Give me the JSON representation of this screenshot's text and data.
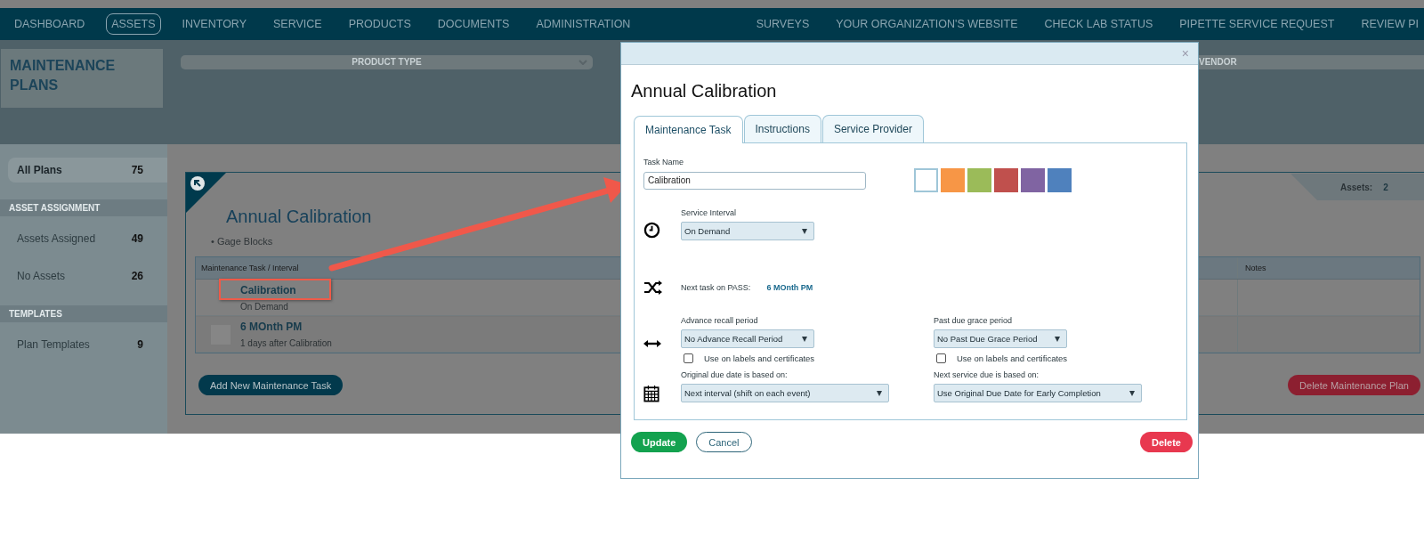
{
  "nav": {
    "items": [
      {
        "label": "DASHBOARD",
        "selected": false
      },
      {
        "label": "ASSETS",
        "selected": true
      },
      {
        "label": "INVENTORY",
        "selected": false
      },
      {
        "label": "SERVICE",
        "selected": false
      },
      {
        "label": "PRODUCTS",
        "selected": false
      },
      {
        "label": "DOCUMENTS",
        "selected": false
      },
      {
        "label": "ADMINISTRATION",
        "selected": false
      }
    ],
    "right_items": [
      {
        "label": "SURVEYS",
        "selected": false
      },
      {
        "label": "YOUR ORGANIZATION'S WEBSITE",
        "selected": false
      },
      {
        "label": "CHECK LAB STATUS",
        "selected": false
      },
      {
        "label": "PIPETTE SERVICE REQUEST",
        "selected": false
      },
      {
        "label": "REVIEW PI",
        "selected": false
      }
    ]
  },
  "page_title": "MAINTENANCE PLANS",
  "filters": [
    {
      "placeholder": "PRODUCT TYPE"
    },
    {
      "placeholder": "VENDOR"
    }
  ],
  "sidebar": {
    "sections": [
      {
        "items": [
          {
            "label": "All Plans",
            "count": "75",
            "selected": true
          }
        ]
      },
      {
        "heading": "ASSET ASSIGNMENT",
        "items": [
          {
            "label": "Assets Assigned",
            "count": "49",
            "selected": false
          },
          {
            "label": "No Assets",
            "count": "26",
            "selected": false
          }
        ]
      },
      {
        "heading": "TEMPLATES",
        "items": [
          {
            "label": "Plan Templates",
            "count": "9",
            "selected": false
          }
        ]
      }
    ]
  },
  "plan": {
    "title": "Annual Calibration",
    "bullets": [
      "• Gage Blocks"
    ],
    "assets_label": "Assets:",
    "assets_count": "2",
    "table": {
      "columns": [
        "Maintenance Task / Interval",
        "Notes"
      ],
      "rows": [
        {
          "name": "Calibration",
          "interval": "On Demand",
          "swatch": false
        },
        {
          "name": "6 MOnth PM",
          "interval": "1 days after Calibration",
          "swatch": true
        }
      ]
    },
    "add_button": "Add New Maintenance Task",
    "delete_button": "Delete Maintenance Plan"
  },
  "modal": {
    "close": "×",
    "title": "Annual Calibration",
    "tabs": [
      {
        "label": "Maintenance Task",
        "selected": true
      },
      {
        "label": "Instructions",
        "selected": false
      },
      {
        "label": "Service Provider",
        "selected": false
      }
    ],
    "task_name": {
      "label": "Task Name",
      "value": "Calibration"
    },
    "colors": [
      {
        "color": "#ffffff",
        "selected": true
      },
      {
        "color": "#f79646",
        "selected": false
      },
      {
        "color": "#9bbb59",
        "selected": false
      },
      {
        "color": "#c0504d",
        "selected": false
      },
      {
        "color": "#8064a2",
        "selected": false
      },
      {
        "color": "#4f81bd",
        "selected": false
      }
    ],
    "service_interval": {
      "label": "Service Interval",
      "value": "On Demand"
    },
    "next_task": {
      "label": "Next task on PASS:",
      "value": "6 MOnth PM"
    },
    "advance_recall": {
      "label": "Advance recall period",
      "value": "No Advance Recall Period",
      "checkbox_label": "Use on labels and certificates",
      "checked": false
    },
    "past_due": {
      "label": "Past due grace period",
      "value": "No Past Due Grace Period",
      "checkbox_label": "Use on labels and certificates",
      "checked": false
    },
    "original_due": {
      "label": "Original due date is based on:",
      "value": "Next interval (shift on each event)"
    },
    "next_service": {
      "label": "Next service due is based on:",
      "value": "Use Original Due Date for Early Completion"
    },
    "update_button": "Update",
    "cancel_button": "Cancel",
    "delete_button": "Delete"
  }
}
